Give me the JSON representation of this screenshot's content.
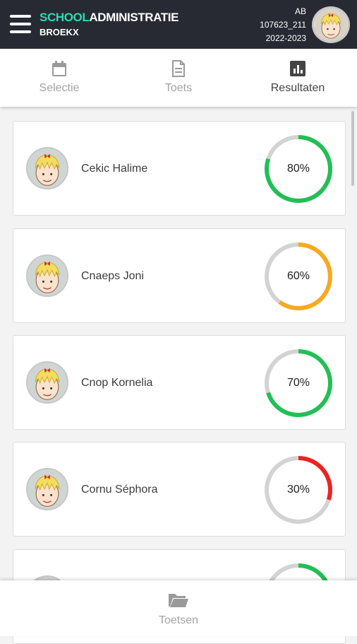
{
  "header": {
    "brand_part1": "SCHOOL",
    "brand_part2": "ADMINISTRATIE",
    "subtitle": "BROEKX",
    "user_initials": "AB",
    "user_code": "107623_211",
    "school_year": "2022-2023"
  },
  "tabs": [
    {
      "label": "Selectie",
      "icon": "calendar-icon",
      "active": false
    },
    {
      "label": "Toets",
      "icon": "document-icon",
      "active": false
    },
    {
      "label": "Resultaten",
      "icon": "bar-chart-icon",
      "active": true
    }
  ],
  "results": [
    {
      "name": "Cekic Halime",
      "score_label": "80%",
      "score": 0.8,
      "color": "#22bf55"
    },
    {
      "name": "Cnaeps Joni",
      "score_label": "60%",
      "score": 0.6,
      "color": "#f8a91e"
    },
    {
      "name": "Cnop Kornelia",
      "score_label": "70%",
      "score": 0.7,
      "color": "#22bf55"
    },
    {
      "name": "Cornu Séphora",
      "score_label": "30%",
      "score": 0.3,
      "color": "#ee2222"
    },
    {
      "name": "",
      "score_label": "",
      "score": 0.8,
      "color": "#22bf55"
    }
  ],
  "colors": {
    "track": "#d3d3d3",
    "header_bg": "#272a33",
    "brand_accent": "#2fd9b4"
  },
  "bottom_nav": {
    "label": "Toetsen",
    "icon": "folder-icon"
  }
}
